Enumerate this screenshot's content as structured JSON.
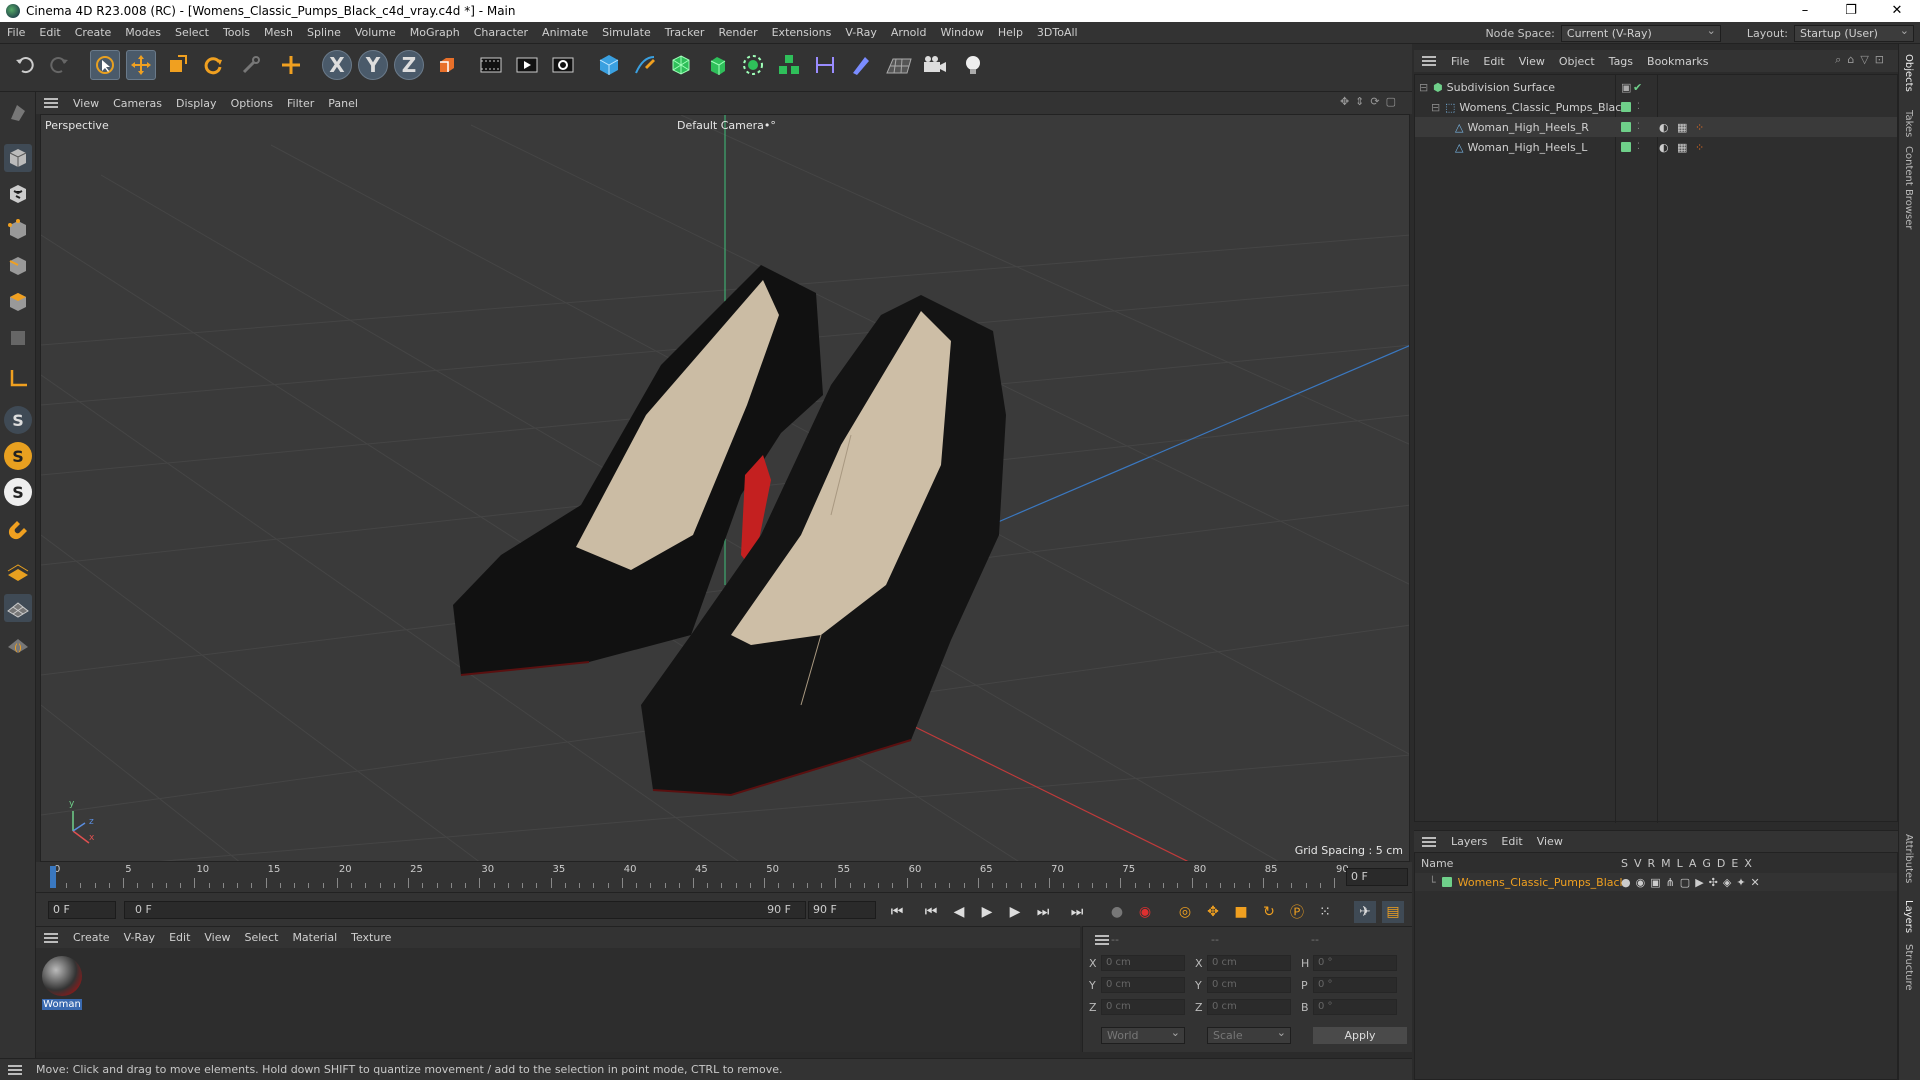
{
  "window": {
    "title": "Cinema 4D R23.008 (RC) - [Womens_Classic_Pumps_Black_c4d_vray.c4d *] - Main",
    "controls": [
      "–",
      "❐",
      "✕"
    ]
  },
  "menubar": {
    "items": [
      "File",
      "Edit",
      "Create",
      "Modes",
      "Select",
      "Tools",
      "Mesh",
      "Spline",
      "Volume",
      "MoGraph",
      "Character",
      "Animate",
      "Simulate",
      "Tracker",
      "Render",
      "Extensions",
      "V-Ray",
      "Arnold",
      "Window",
      "Help",
      "3DToAll"
    ],
    "node_space_label": "Node Space:",
    "node_space_value": "Current (V-Ray)",
    "layout_label": "Layout:",
    "layout_value": "Startup (User)"
  },
  "toolbar": {
    "icons": [
      "undo-icon",
      "redo-icon",
      "select-live-icon",
      "move-icon",
      "scale-icon",
      "rotate-icon",
      "recent-tool-icon",
      "axis-icon",
      "x-axis-icon",
      "y-axis-icon",
      "z-axis-icon",
      "coordinate-system-icon",
      "render-view-icon",
      "render-picture-viewer-icon",
      "render-settings-icon",
      "cube-icon",
      "pen-icon",
      "subdivision-icon",
      "extrude-icon",
      "cloner-icon",
      "mograph-icon",
      "deformer-icon",
      "field-icon",
      "floor-icon",
      "camera-icon",
      "light-icon"
    ],
    "axis_labels": [
      "X",
      "Y",
      "Z"
    ]
  },
  "viewport": {
    "menu": [
      "View",
      "Cameras",
      "Display",
      "Options",
      "Filter",
      "Panel"
    ],
    "projection_label": "Perspective",
    "camera_label": "Default Camera",
    "camera_suffix": "•°",
    "grid_spacing": "Grid Spacing : 5 cm",
    "axis_labels": [
      "y",
      "z",
      "x"
    ],
    "colors": {
      "background": "#3a3a3a",
      "grid": "#454545",
      "shoe": "#111111",
      "lining": "#c8b8a0",
      "sole": "#c42020"
    }
  },
  "timeline": {
    "ticks": [
      "0",
      "5",
      "10",
      "15",
      "20",
      "25",
      "30",
      "35",
      "40",
      "45",
      "50",
      "55",
      "60",
      "65",
      "70",
      "75",
      "80",
      "85",
      "90"
    ],
    "current_frame": "0 F",
    "start_field": "0 F",
    "range_start": "0 F",
    "range_end": "90 F",
    "end_field": "90 F"
  },
  "materials": {
    "menu": [
      "Create",
      "V-Ray",
      "Edit",
      "View",
      "Select",
      "Material",
      "Texture"
    ],
    "items": [
      {
        "name": "Woman"
      }
    ]
  },
  "coordinates": {
    "headers": [
      "--",
      "--",
      "--"
    ],
    "rows": [
      {
        "pos_label": "X",
        "pos": "0 cm",
        "size_label": "X",
        "size": "0 cm",
        "rot_label": "H",
        "rot": "0 °"
      },
      {
        "pos_label": "Y",
        "pos": "0 cm",
        "size_label": "Y",
        "size": "0 cm",
        "rot_label": "P",
        "rot": "0 °"
      },
      {
        "pos_label": "Z",
        "pos": "0 cm",
        "size_label": "Z",
        "size": "0 cm",
        "rot_label": "B",
        "rot": "0 °"
      }
    ],
    "mode_world": "World",
    "mode_scale": "Scale",
    "apply_label": "Apply"
  },
  "status": {
    "message": "Move: Click and drag to move elements. Hold down SHIFT to quantize movement / add to the selection in point mode, CTRL to remove."
  },
  "objects": {
    "menu": [
      "File",
      "Edit",
      "View",
      "Object",
      "Tags",
      "Bookmarks"
    ],
    "items": [
      {
        "name": "Subdivision Surface",
        "indent": 0
      },
      {
        "name": "Womens_Classic_Pumps_Black",
        "indent": 1
      },
      {
        "name": "Woman_High_Heels_R",
        "indent": 2
      },
      {
        "name": "Woman_High_Heels_L",
        "indent": 2
      }
    ]
  },
  "layers": {
    "menu": [
      "Layers",
      "Edit",
      "View"
    ],
    "name_header": "Name",
    "columns": [
      "S",
      "V",
      "R",
      "M",
      "L",
      "A",
      "G",
      "D",
      "E",
      "X"
    ],
    "items": [
      {
        "name": "Womens_Classic_Pumps_Black",
        "color": "#6fd08a"
      }
    ]
  },
  "right_tabs": [
    "Objects",
    "Takes",
    "Content Browser",
    "Attributes",
    "Layers",
    "Structure"
  ]
}
